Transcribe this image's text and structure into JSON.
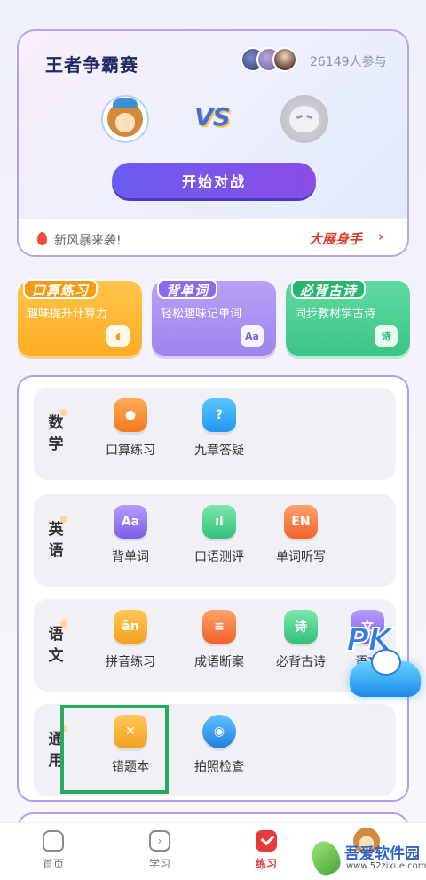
{
  "battle": {
    "title": "王者争霸赛",
    "participants": "26149人参与",
    "vs": "VS",
    "start_button": "开始对战",
    "news": "新风暴来袭!",
    "show_link": "大展身手",
    "show_chevron": "›"
  },
  "quick_cards": [
    {
      "title": "口算练习",
      "subtitle": "趣味提升计算力",
      "icon": "Aa"
    },
    {
      "title": "背单词",
      "subtitle": "轻松趣味记单词",
      "icon": "Aa"
    },
    {
      "title": "必背古诗",
      "subtitle": "同步教材学古诗",
      "icon": "诗"
    }
  ],
  "subjects": [
    {
      "label": "数学",
      "items": [
        {
          "label": "口算练习",
          "icon": "calc-icon",
          "glyph": "●"
        },
        {
          "label": "九章答疑",
          "icon": "question-icon",
          "glyph": "?"
        }
      ]
    },
    {
      "label": "英语",
      "items": [
        {
          "label": "背单词",
          "icon": "word-card-icon",
          "glyph": "Aa"
        },
        {
          "label": "口语测评",
          "icon": "voice-icon",
          "glyph": "ıl"
        },
        {
          "label": "单词听写",
          "icon": "en-icon",
          "glyph": "EN"
        }
      ]
    },
    {
      "label": "语文",
      "items": [
        {
          "label": "拼音练习",
          "icon": "pinyin-icon",
          "glyph": "ān"
        },
        {
          "label": "成语断案",
          "icon": "idiom-icon",
          "glyph": "≡"
        },
        {
          "label": "必背古诗",
          "icon": "poem-icon",
          "glyph": "诗"
        },
        {
          "label": "语文",
          "icon": "chinese-icon",
          "glyph": "文"
        }
      ]
    },
    {
      "label": "通用",
      "items": [
        {
          "label": "错题本",
          "icon": "wrong-book-icon",
          "glyph": "✕"
        },
        {
          "label": "拍照检查",
          "icon": "camera-icon",
          "glyph": "◉"
        }
      ]
    }
  ],
  "pk_badge": "PK",
  "nav": [
    {
      "label": "首页",
      "icon": "home-icon"
    },
    {
      "label": "学习",
      "icon": "study-icon"
    },
    {
      "label": "练习",
      "icon": "practice-icon"
    }
  ],
  "watermark": {
    "title": "吾爱软件园",
    "url": "www.52zixue.com"
  },
  "colors": {
    "accent": "#7a56ee",
    "active_nav": "#e63b3b",
    "highlight": "#28a860"
  }
}
